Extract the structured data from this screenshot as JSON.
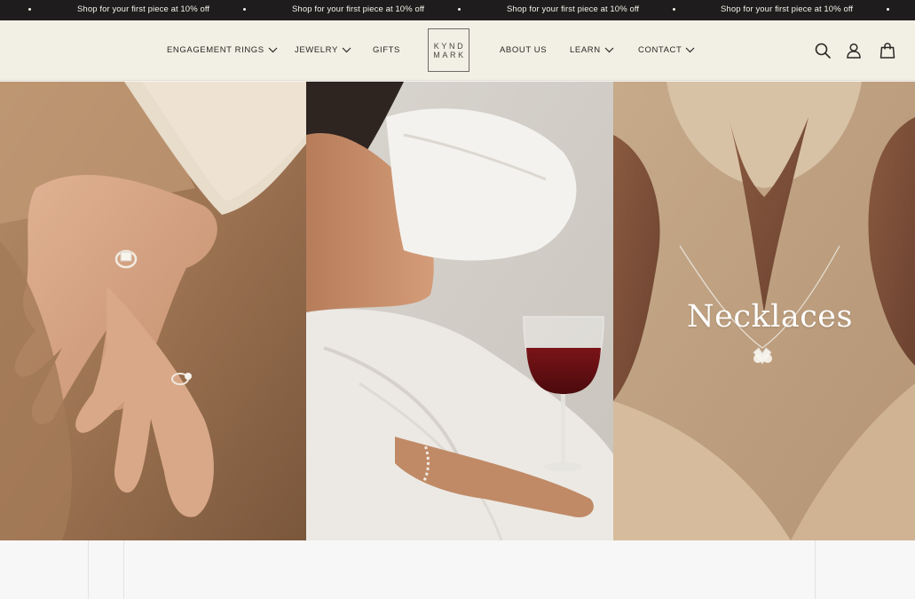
{
  "announcement": {
    "messages": [
      "Shop for your first piece at 10% off",
      "Shop for your first piece at 10% off",
      "Shop for your first piece at 10% off",
      "Shop for your first piece at 10% off"
    ]
  },
  "header": {
    "nav_left": [
      {
        "label": "ENGAGEMENT RINGS",
        "has_dropdown": true
      },
      {
        "label": "JEWELRY",
        "has_dropdown": true
      },
      {
        "label": "GIFTS",
        "has_dropdown": false
      }
    ],
    "logo": {
      "line1": "KYND",
      "line2": "MARK"
    },
    "nav_right": [
      {
        "label": "ABOUT US",
        "has_dropdown": false
      },
      {
        "label": "LEARN",
        "has_dropdown": true
      },
      {
        "label": "CONTACT",
        "has_dropdown": true
      }
    ],
    "icons": [
      "search-icon",
      "account-icon",
      "bag-icon"
    ]
  },
  "hero": {
    "featured_label": "Necklaces"
  },
  "colors": {
    "announcement_bg": "#1e1c1c",
    "header_bg": "#f2efe5",
    "text": "#2b2825",
    "page_bg": "#f8f7f7"
  }
}
